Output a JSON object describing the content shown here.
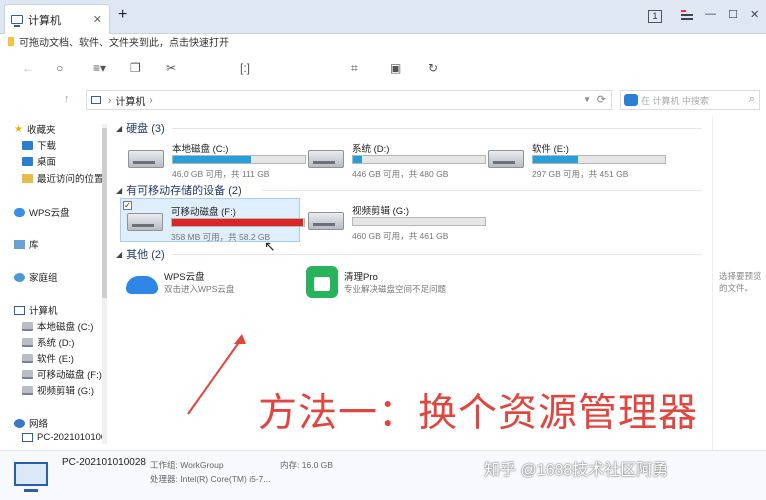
{
  "tab": {
    "title": "计算机",
    "close": "✕",
    "new_tab": "+"
  },
  "window": {
    "badge": "1",
    "minimize": "—",
    "maximize": "☐",
    "close": "✕"
  },
  "bookmark_bar": {
    "hint": "可拖动文档、软件、文件夹到此，点击快速打开"
  },
  "address": {
    "crumb": "计算机",
    "separator": "›"
  },
  "search": {
    "placeholder": "在 计算机 中搜索"
  },
  "sidebar": {
    "items": [
      {
        "label": "收藏夹"
      },
      {
        "label": "下载"
      },
      {
        "label": "桌面"
      },
      {
        "label": "最近访问的位置"
      },
      {
        "label": "WPS云盘"
      },
      {
        "label": "库"
      },
      {
        "label": "家庭组"
      },
      {
        "label": "计算机"
      },
      {
        "label": "本地磁盘 (C:)"
      },
      {
        "label": "系统 (D:)"
      },
      {
        "label": "软件 (E:)"
      },
      {
        "label": "可移动磁盘 (F:)"
      },
      {
        "label": "视频剪辑 (G:)"
      },
      {
        "label": "网络"
      },
      {
        "label": "PC-2021010100"
      }
    ]
  },
  "groups": {
    "hard_disks": "硬盘 (3)",
    "removable": "有可移动存储的设备 (2)",
    "other": "其他 (2)"
  },
  "drives": [
    {
      "name": "本地磁盘 (C:)",
      "info": "46.0 GB 可用，共 111 GB",
      "used_fraction": 0.59
    },
    {
      "name": "系统 (D:)",
      "info": "446 GB 可用，共 480 GB",
      "used_fraction": 0.07
    },
    {
      "name": "软件 (E:)",
      "info": "297 GB 可用，共 451 GB",
      "used_fraction": 0.34
    },
    {
      "name": "可移动磁盘 (F:)",
      "info": "358 MB 可用，共 58.2 GB",
      "used_fraction": 0.99
    },
    {
      "name": "视频剪辑 (G:)",
      "info": "460 GB 可用，共 461 GB",
      "used_fraction": 0.0
    }
  ],
  "apps": [
    {
      "name": "WPS云盘",
      "desc": "双击进入WPS云盘"
    },
    {
      "name": "清理Pro",
      "desc": "专业解决磁盘空间不足问题"
    }
  ],
  "right_pane": {
    "line1": "选择要预览",
    "line2": "的文件。"
  },
  "annotation": "方法一：换个资源管理器",
  "details": {
    "name": "PC-202101010028",
    "workgroup_label": "工作组:",
    "workgroup": "WorkGroup",
    "memory_label": "内存:",
    "memory": "16.0 GB",
    "cpu_label": "处理器:",
    "cpu": "Intel(R) Core(TM) i5-7..."
  },
  "watermark": "知乎 @1688技术社区阿勇"
}
